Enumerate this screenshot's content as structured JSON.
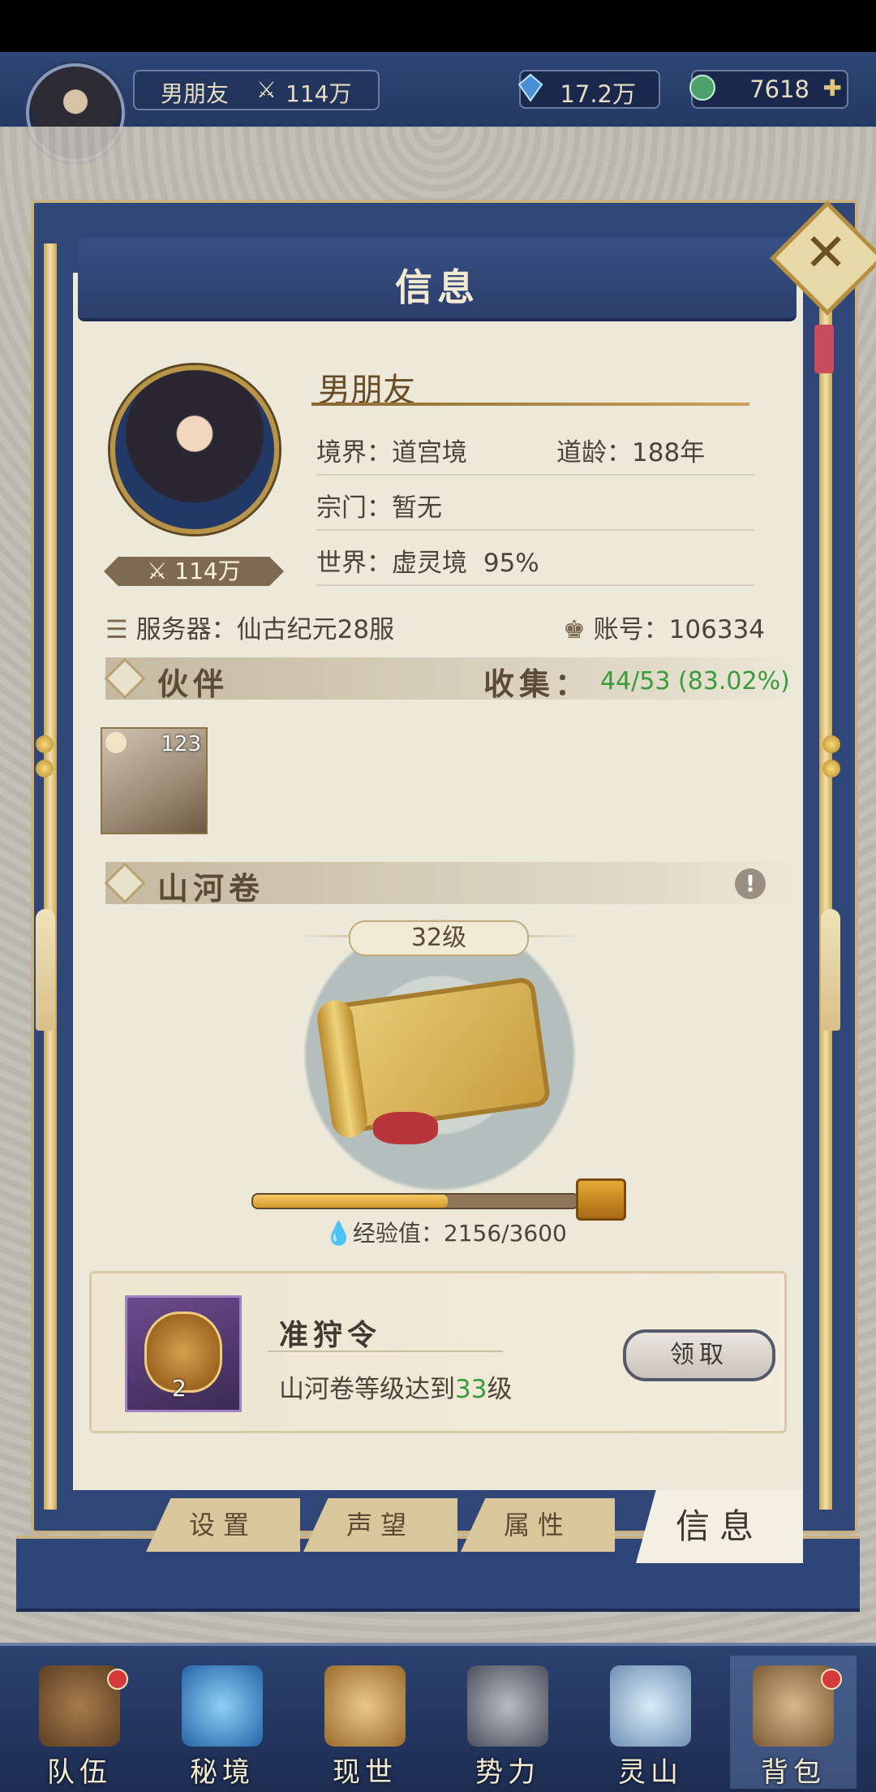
{
  "player": {
    "name": "男朋友",
    "power": "114万",
    "realm_label": "境界：",
    "realm_value": "道宫境",
    "age_label": "道龄：",
    "age_value": "188年",
    "sect_label": "宗门：",
    "sect_value": "暂无",
    "world_label": "世界：",
    "world_value": "虚灵境",
    "world_progress": "95%",
    "server_label": "服务器：",
    "server_value": "仙古纪元28服",
    "account_label": "账号：",
    "account_value": "106334"
  },
  "currency": {
    "crystal": "17.2万",
    "jade": "7618"
  },
  "panel": {
    "title": "信息"
  },
  "companions": {
    "title": "伙伴",
    "collect_label": "收集：",
    "collect_value": "44/53 (83.02%)",
    "items": [
      {
        "level": "123"
      }
    ]
  },
  "scroll": {
    "title": "山河卷",
    "level": "32级",
    "exp_label": "经验值：",
    "exp_value": "2156/3600",
    "exp_current": 2156,
    "exp_max": 3600
  },
  "quest": {
    "title": "准狩令",
    "desc_prefix": "山河卷等级达到",
    "desc_level": "33",
    "desc_suffix": "级",
    "item_count": "2",
    "claim_label": "领取"
  },
  "tabs": [
    "设置",
    "声望",
    "属性",
    "信息"
  ],
  "bottom_nav": [
    "队伍",
    "秘境",
    "现世",
    "势力",
    "灵山",
    "背包"
  ],
  "colors": {
    "accent_green": "#3b9b3b",
    "panel_blue": "#2f4677",
    "paper": "#ece8da",
    "badge_red": "#d43a3a"
  }
}
